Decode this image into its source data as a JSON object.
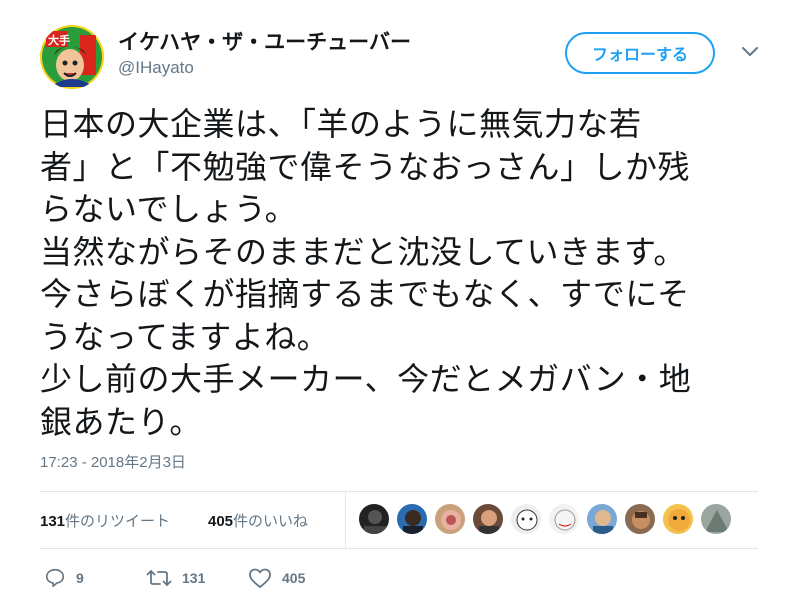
{
  "author": {
    "display_name": "イケハヤ・ザ・ユーチューバー",
    "handle": "@IHayato",
    "avatar": "avatar-illustration"
  },
  "follow_label": "フォローする",
  "more_icon": "chevron-down-icon",
  "tweet_lines": [
    "日本の大企業は、「羊のように無気力な若",
    "者」と「不勉強で偉そうなおっさん」しか残",
    "らないでしょう。",
    "当然ながらそのままだと沈没していきます。",
    "今さらぼくが指摘するまでもなく、すでにそ",
    "うなってますよね。",
    "少し前の大手メーカー、今だとメガバン・地",
    "銀あたり。"
  ],
  "timestamp": "17:23 - 2018年2月3日",
  "stats": {
    "retweet_count": "131",
    "retweet_label": "件のリツイート",
    "like_count": "405",
    "like_label": "件のいいね"
  },
  "liker_avatars": [
    "avatar-1",
    "avatar-2",
    "avatar-3",
    "avatar-4",
    "avatar-5",
    "avatar-6",
    "avatar-7",
    "avatar-8",
    "avatar-9",
    "avatar-10"
  ],
  "actions": {
    "reply_count": "9",
    "retweet_count": "131",
    "like_count": "405"
  },
  "colors": {
    "accent": "#1da1f2",
    "muted": "#657786",
    "text": "#14171a",
    "divider": "#e1e8ed"
  }
}
